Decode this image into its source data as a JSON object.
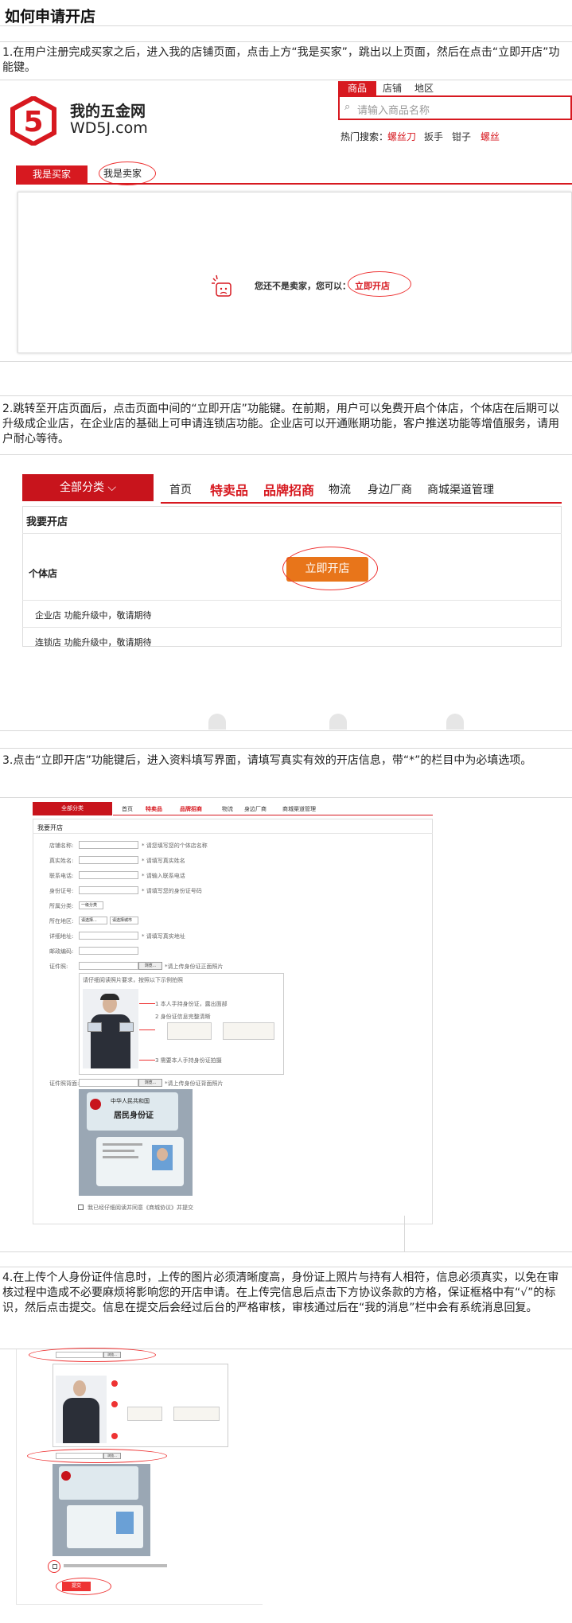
{
  "title": "如何申请开店",
  "steps": [
    {
      "text": "1.在用户注册完成买家之后，进入我的店铺页面，点击上方“我是买家”，跳出以上页面，然后在点击“立即开店”功能键。"
    },
    {
      "text": "2.跳转至开店页面后，点击页面中间的“立即开店”功能键。在前期，用户可以免费开启个体店，个体店在后期可以升级成企业店，在企业店的基础上可申请连锁店功能。企业店可以开通账期功能，客户推送功能等增值服务，请用户耐心等待。"
    },
    {
      "text": "3.点击“立即开店”功能键后，进入资料填写界面，请填写真实有效的开店信息，带“*”的栏目中为必填选项。"
    },
    {
      "text": "4.在上传个人身份证件信息时，上传的图片必须清晰度高，身份证上照片与持有人相符，信息必须真实，以免在审核过程中造成不必要麻烦将影响您的开店申请。在上传完信息后点击下方协议条款的方格，保证框格中有“√”的标识，然后点击提交。信息在提交后会经过后台的严格审核，审核通过后在“我的消息”栏中会有系统消息回复。"
    }
  ],
  "shot1": {
    "logo_digit": "5",
    "logo_name": "我的五金网",
    "logo_domain": "WD5J.com",
    "search_tabs": [
      "商品",
      "店铺",
      "地区"
    ],
    "search_placeholder": "请输入商品名称",
    "hot_label": "热门搜索：",
    "hot_items": [
      "螺丝刀",
      "扳手",
      "钳子",
      "螺丝"
    ],
    "tab_buyer": "我是买家",
    "tab_seller": "我是卖家",
    "not_seller": "您还不是卖家，您可以：",
    "open_link": "立即开店"
  },
  "shot2": {
    "all_cat": "全部分类",
    "nav": [
      "首页",
      "特卖品",
      "品牌招商",
      "物流",
      "身边厂商",
      "商城渠道管理"
    ],
    "section_title": "我要开店",
    "individual": "个体店",
    "open_button": "立即开店",
    "enterprise": "企业店 功能升级中，敬请期待",
    "chain": "连锁店 功能升级中，敬请期待"
  },
  "shot3": {
    "all_cat": "全部分类",
    "nav": [
      "首页",
      "特卖品",
      "品牌招商",
      "物流",
      "身边厂商",
      "商城渠道管理"
    ],
    "section_title": "我要开店",
    "fields": [
      "店铺名称:",
      "真实姓名:",
      "联系电话:",
      "身份证号:",
      "所属分类:",
      "所在地区:",
      "详细地址:",
      "邮政编码:"
    ],
    "hints": [
      "* 请您填写您的个体店名称",
      "* 请填写真实姓名",
      "* 请输入联系电话",
      "* 请填写您的身份证号码",
      "",
      "",
      "* 请填写真实地址",
      ""
    ],
    "select_cat": "一级分类",
    "select_prov": "请选择...",
    "select_city": "请选择城市",
    "upload1_label": "证件照:",
    "upload2_label": "证件照背面:",
    "browse": "浏览...",
    "upload_hint": "*请上传身份证正面照片",
    "upload_hint2": "*请上传身份证背面照片",
    "example_title": "请仔细阅读照片要求，按照以下示例拍照",
    "example_items": [
      "1 本人手持身份证，露出面部",
      "2 身份证信息完整清晰",
      "3 需要本人手持身份证拍摄"
    ],
    "id_title": "中华人民共和国",
    "id_sub": "居民身份证",
    "agree": "我已经仔细阅读并同意《商城协议》并提交"
  },
  "shot4": {
    "submit": "提交"
  }
}
